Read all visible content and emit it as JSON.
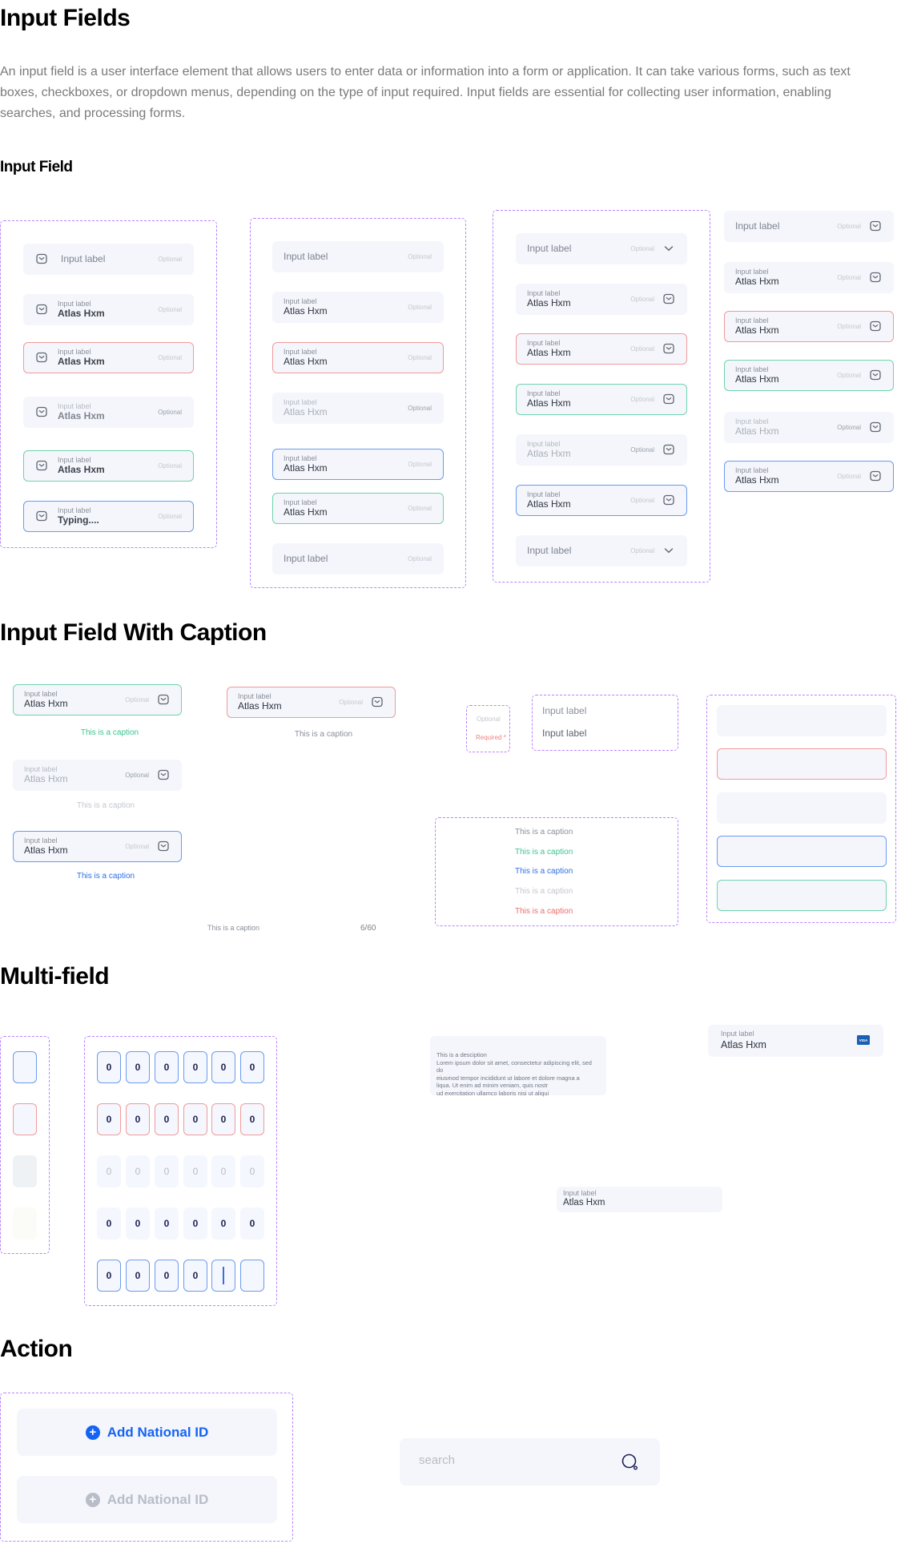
{
  "page": {
    "title": "Input Fields",
    "description": "An input field is a user interface element that allows users to enter data or information into a form or application. It can take various forms, such as text boxes, checkboxes, or dropdown menus, depending on the type of input required. Input fields are essential for collecting user information, enabling searches, and processing forms.",
    "section_input_field": "Input Field",
    "section_caption": "Input Field With Caption",
    "section_multi": "Multi-field",
    "section_action": "Action"
  },
  "colors": {
    "error": "#f29a9a",
    "success": "#6ed3ad",
    "focus": "#6b9bef",
    "frame_dash": "#b983ff",
    "primary": "#1463f3",
    "caption_default": "#8a8f9a",
    "caption_success": "#3cc48f",
    "caption_focus": "#2f6fe6",
    "caption_disabled": "#c3c7cf",
    "caption_error": "#f06a6a"
  },
  "input_field": {
    "columns": [
      {
        "icon": "mail-icon",
        "icon_position": "leading",
        "fields": [
          {
            "state": "default",
            "label": "Input label",
            "optional": "Optional"
          },
          {
            "state": "filled",
            "label": "Input label",
            "value": "Atlas Hxm",
            "optional": "Optional"
          },
          {
            "state": "error",
            "label": "Input label",
            "value": "Atlas Hxm",
            "optional": "Optional"
          },
          {
            "state": "disabled",
            "label": "Input label",
            "value": "Atlas Hxm",
            "optional": "Optional"
          },
          {
            "state": "success",
            "label": "Input label",
            "value": "Atlas Hxm",
            "optional": "Optional"
          },
          {
            "state": "focus",
            "label": "Input label",
            "value": "Typing....",
            "optional": "Optional"
          }
        ]
      },
      {
        "icon": "none",
        "icon_position": "none",
        "fields": [
          {
            "state": "default",
            "label": "Input label",
            "optional": "Optional"
          },
          {
            "state": "filled",
            "label": "Input label",
            "value": "Atlas Hxm",
            "optional": "Optional"
          },
          {
            "state": "error",
            "label": "Input label",
            "value": "Atlas Hxm",
            "optional": "Optional"
          },
          {
            "state": "disabled",
            "label": "Input label",
            "value": "Atlas Hxm",
            "optional": "Optional"
          },
          {
            "state": "focus",
            "label": "Input label",
            "value": "Atlas Hxm",
            "optional": "Optional"
          },
          {
            "state": "success",
            "label": "Input label",
            "value": "Atlas Hxm",
            "optional": "Optional"
          },
          {
            "state": "default",
            "label": "Input label",
            "optional": "Optional"
          }
        ]
      },
      {
        "icon": "mail-icon",
        "icon_position": "trailing",
        "fields": [
          {
            "state": "default",
            "label": "Input label",
            "optional": "Optional",
            "icon": "chevron-down-icon"
          },
          {
            "state": "filled",
            "label": "Input label",
            "value": "Atlas Hxm",
            "optional": "Optional"
          },
          {
            "state": "error",
            "label": "Input label",
            "value": "Atlas Hxm",
            "optional": "Optional"
          },
          {
            "state": "success",
            "label": "Input label",
            "value": "Atlas Hxm",
            "optional": "Optional"
          },
          {
            "state": "disabled",
            "label": "Input label",
            "value": "Atlas Hxm",
            "optional": "Optional"
          },
          {
            "state": "focus",
            "label": "Input label",
            "value": "Atlas Hxm",
            "optional": "Optional"
          },
          {
            "state": "default",
            "label": "Input label",
            "optional": "Optional",
            "icon": "chevron-down-icon"
          }
        ]
      },
      {
        "icon": "mail-icon",
        "icon_position": "trailing",
        "fields": [
          {
            "state": "default",
            "label": "Input label",
            "optional": "Optional"
          },
          {
            "state": "filled",
            "label": "Input label",
            "value": "Atlas Hxm",
            "optional": "Optional"
          },
          {
            "state": "error",
            "label": "Input label",
            "value": "Atlas Hxm",
            "optional": "Optional"
          },
          {
            "state": "success",
            "label": "Input label",
            "value": "Atlas Hxm",
            "optional": "Optional"
          },
          {
            "state": "disabled",
            "label": "Input label",
            "value": "Atlas Hxm",
            "optional": "Optional"
          },
          {
            "state": "focus",
            "label": "Input label",
            "value": "Atlas Hxm",
            "optional": "Optional"
          }
        ]
      }
    ]
  },
  "caption_section": {
    "fields": [
      {
        "state": "success",
        "label": "Input label",
        "value": "Atlas Hxm",
        "optional": "Optional",
        "caption": "This is a caption",
        "caption_color": "#3cc48f"
      },
      {
        "state": "disabled",
        "label": "Input label",
        "value": "Atlas Hxm",
        "optional": "Optional",
        "caption": "This is a caption",
        "caption_color": "#c3c7cf"
      },
      {
        "state": "focus",
        "label": "Input label",
        "value": "Atlas Hxm",
        "optional": "Optional",
        "caption": "This is a caption",
        "caption_color": "#2f6fe6"
      },
      {
        "state": "error",
        "label": "Input label",
        "value": "Atlas Hxm",
        "optional": "Optional",
        "caption": "This is a caption",
        "caption_color": "#8a8f9a"
      }
    ],
    "helper_caption": "This is a caption",
    "char_counter": "6/60",
    "tags": {
      "optional": "Optional",
      "required": "Required *"
    },
    "labels": [
      {
        "text": "Input label",
        "color": "#8a8f9a"
      },
      {
        "text": "Input label",
        "color": "#5b616d"
      }
    ],
    "captions": [
      {
        "text": "This is a caption",
        "color": "#8a8f9a"
      },
      {
        "text": "This is a caption",
        "color": "#3cc48f"
      },
      {
        "text": "This is a caption",
        "color": "#2f6fe6"
      },
      {
        "text": "This is a caption",
        "color": "#c3c7cf"
      },
      {
        "text": "This is a caption",
        "color": "#f06a6a"
      }
    ],
    "empty_fields": [
      "default",
      "error",
      "disabled",
      "focus",
      "success"
    ]
  },
  "multi_field": {
    "single_cells": [
      "focus",
      "error",
      "disabled-empty",
      "faint"
    ],
    "otp_rows": [
      {
        "state": "focus",
        "values": [
          "0",
          "0",
          "0",
          "0",
          "0",
          "0"
        ]
      },
      {
        "state": "error",
        "values": [
          "0",
          "0",
          "0",
          "0",
          "0",
          "0"
        ]
      },
      {
        "state": "disabled",
        "values": [
          "0",
          "0",
          "0",
          "0",
          "0",
          "0"
        ]
      },
      {
        "state": "default",
        "values": [
          "0",
          "0",
          "0",
          "0",
          "0",
          "0"
        ]
      },
      {
        "state": "focus",
        "values": [
          "0",
          "0",
          "0",
          "0",
          "",
          ""
        ],
        "cursor_index": 4
      }
    ],
    "description_box": {
      "title": "This is a desciption",
      "lines": [
        "Lorem ipsum dolor sit amet, consectetur adipiscing elit, sed do",
        "eiusmod tempor incididunt ut labore et dolore magna a",
        "liqua. Ut enim ad minim veniam, quis nostr",
        "ud exercitation ullamco laboris nisi ut aliqui"
      ]
    },
    "card_field": {
      "label": "Input label",
      "value": "Atlas Hxm",
      "badge": "VISA",
      "badge_color": "#1a5fb4"
    },
    "plain_field": {
      "label": "Input label",
      "value": "Atlas Hxm"
    }
  },
  "action": {
    "buttons": [
      {
        "label": "Add National ID",
        "state": "active",
        "icon": "plus-circle-icon",
        "color": "#1463f3"
      },
      {
        "label": "Add National ID",
        "state": "disabled",
        "icon": "plus-circle-icon",
        "color": "#b8bdc7"
      }
    ],
    "search": {
      "placeholder": "search",
      "icon": "search-icon"
    }
  }
}
